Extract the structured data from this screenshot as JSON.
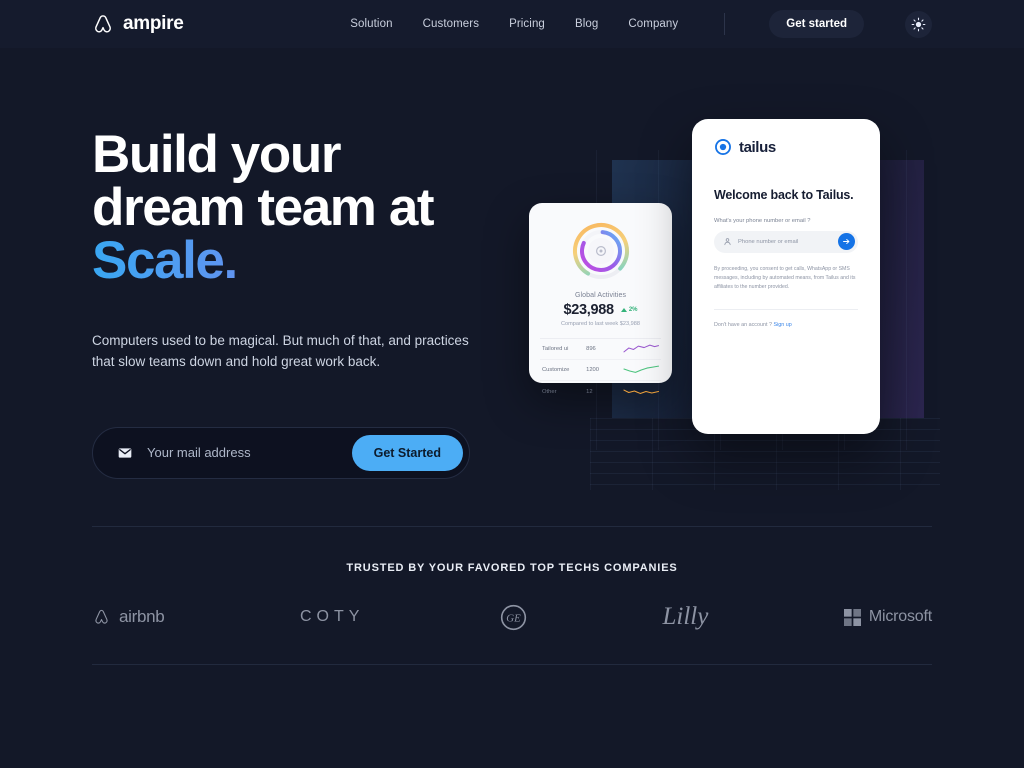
{
  "header": {
    "brand": {
      "name": "ampire",
      "icon": "ampire-drop-logo"
    },
    "nav": [
      {
        "label": "Solution"
      },
      {
        "label": "Customers"
      },
      {
        "label": "Pricing"
      },
      {
        "label": "Blog"
      },
      {
        "label": "Company"
      }
    ],
    "cta": "Get started",
    "theme_toggle_icon": "sun-icon"
  },
  "hero": {
    "title_line1": "Build your",
    "title_line2": "dream team at",
    "title_accent": "Scale.",
    "subtitle": "Computers used to be magical. But much of that, and practices that slow teams down and hold great work back.",
    "form": {
      "icon": "envelope-icon",
      "placeholder": "Your mail address",
      "value": "",
      "button": "Get Started"
    },
    "accent_gradient_from": "#39a7f2",
    "accent_gradient_to": "#9b7ff0"
  },
  "dashboard_card": {
    "label": "Global Activities",
    "figure": "$23,988",
    "delta": "2%",
    "delta_direction": "up",
    "compare": "Compared to last week $23,988",
    "rows": [
      {
        "name": "Tailored ui",
        "value": "896",
        "spark_color": "#9b59d0"
      },
      {
        "name": "Customize",
        "value": "1200",
        "spark_color": "#4cc47e"
      },
      {
        "name": "Other",
        "value": "12",
        "spark_color": "#efa23c"
      }
    ],
    "donut": {
      "outer_from": "#f7b martyr",
      "outer_colors": [
        "#f9b25a",
        "#5ad7e0",
        "#47c9f0"
      ],
      "inner_colors": [
        "#b84fe0",
        "#8e5ce8",
        "#62b6f2"
      ]
    }
  },
  "tailus_card": {
    "brand": "tailus",
    "brand_icon": "tailus-target-icon",
    "welcome": "Welcome back to Tailus.",
    "question": "What's your phone number or email ?",
    "field": {
      "icon": "user-icon",
      "placeholder": "Phone number or email",
      "value": "",
      "submit_icon": "arrow-right-icon"
    },
    "legal": "By proceeding, you consent to get calls, WhatsApp or SMS messages, including by automated means, from Tailus and its affiliates to the number provided.",
    "footer_text": "Don't have an account ?",
    "footer_link": "Sign up"
  },
  "trusted": {
    "title": "TRUSTED BY YOUR FAVORED TOP TECHS COMPANIES",
    "logos": [
      {
        "name": "airbnb",
        "icon": "airbnb-icon"
      },
      {
        "name": "COTY",
        "icon": "coty-wordmark"
      },
      {
        "name": "GE",
        "icon": "ge-icon"
      },
      {
        "name": "Lilly",
        "icon": "lilly-wordmark"
      },
      {
        "name": "Microsoft",
        "icon": "microsoft-icon"
      }
    ]
  }
}
